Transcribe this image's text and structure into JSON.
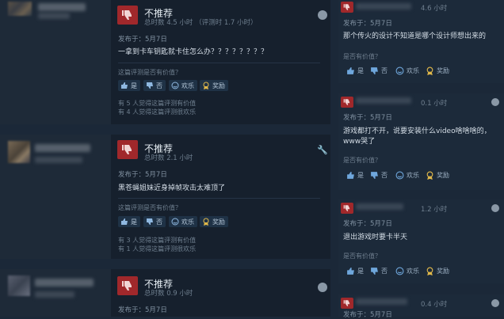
{
  "left_reviews": [
    {
      "verdict": "不推荐",
      "hours": "总时数 4.5 小时 （评测时 1.7 小时）",
      "posted": "发布于：5月7日",
      "text": "一拿到卡车钥匙就卡住怎么办？？？？？？？？",
      "question": "这篇评测是否有价值？",
      "votes": {
        "yes": "是",
        "no": "否",
        "funny": "欢乐",
        "award": "奖励"
      },
      "helpful": [
        "有 5 人觉得这篇评测有价值",
        "有 4 人觉得这篇评测很欢乐"
      ]
    },
    {
      "verdict": "不推荐",
      "hours": "总时数 2.1 小时",
      "posted": "发布于：5月7日",
      "text": "黑苍蝇姐妹近身掉帧攻击太难顶了",
      "question": "这篇评测是否有价值？",
      "votes": {
        "yes": "是",
        "no": "否",
        "funny": "欢乐",
        "award": "奖励"
      },
      "helpful": [
        "有 3 人觉得这篇评测有价值",
        "有 1 人觉得这篇评测很欢乐"
      ]
    },
    {
      "verdict": "不推荐",
      "hours": "总时数 0.9 小时",
      "posted": "发布于：5月7日"
    }
  ],
  "right_reviews": [
    {
      "hours": "4.6 小时",
      "posted": "发布于：5月7日",
      "text": "那个传火的设计不知道是哪个设计师想出来的",
      "question": "是否有价值？",
      "votes": {
        "yes": "是",
        "no": "否",
        "funny": "欢乐",
        "award": "奖励"
      }
    },
    {
      "hours": "0.1 小时",
      "posted": "发布于：5月7日",
      "text_lines": [
        "游戏都打不开，说要安装什么video啥啥啥的，",
        "www哭了"
      ],
      "question": "是否有价值？",
      "votes": {
        "yes": "是",
        "no": "否",
        "funny": "欢乐",
        "award": "奖励"
      }
    },
    {
      "hours": "1.2 小时",
      "posted": "发布于：5月7日",
      "text": "退出游戏时要卡半天",
      "question": "是否有价值？",
      "votes": {
        "yes": "是",
        "no": "否",
        "funny": "欢乐",
        "award": "奖励"
      }
    },
    {
      "hours": "0.4 小时",
      "posted": "发布于：5月7日"
    }
  ]
}
